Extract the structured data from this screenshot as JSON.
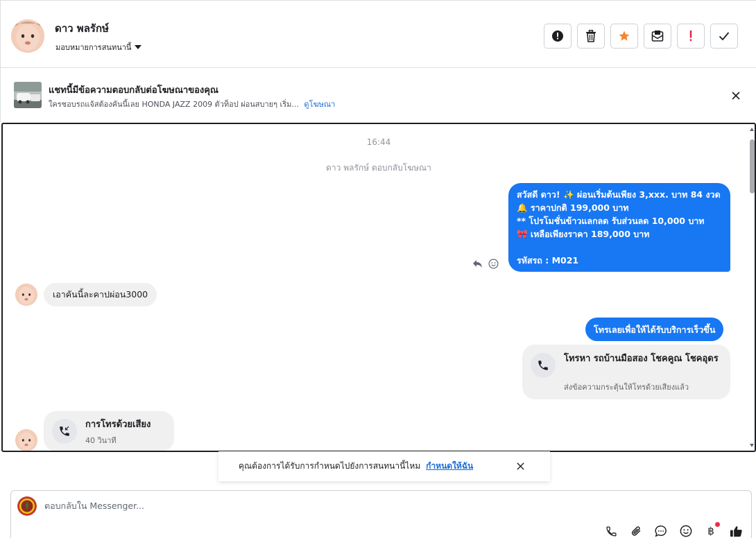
{
  "header": {
    "contact_name": "ดาว พลรักษ์",
    "assign_label": "มอบหมายการสนทนานี้",
    "actions": [
      {
        "icon": "exclamation-circle-icon"
      },
      {
        "icon": "trash-icon"
      },
      {
        "icon": "star-icon"
      },
      {
        "icon": "mark-unread-icon"
      },
      {
        "icon": "spam-exclamation-icon"
      },
      {
        "icon": "check-icon"
      }
    ]
  },
  "ad_banner": {
    "title": "แชทนี้มีข้อความตอบกลับต่อโฆษณาของคุณ",
    "snippet": "ใครชอบรถแจ้สต้องคันนี้เลย HONDA JAZZ 2009 ตัวท็อป ผ่อนสบายๆ เริ่ม...",
    "link": "ดูโฆษณา"
  },
  "chat": {
    "timestamp": "16:44",
    "replied_note": "ดาว พลรักษ์ ตอบกลับโฆษณา",
    "outgoing_ad_message": {
      "lines": [
        "สวัสดี ดาว! ✨  ผ่อนเริ่มต้นเพียง 3,xxx. บาท 84 งวด",
        "🔔 ราคาปกติ 199,000 บาท",
        "** โปรโมชั่นข้าวแลกลด รับส่วนลด 10,000 บาท",
        "🎀  เหลือเพียงราคา 189,000 บาท",
        "",
        " รหัสรถ : M021"
      ]
    },
    "incoming_message": "เอาคันนี้ละคาปผ่อน3000",
    "outgoing_call_prompt": "โทรเลยเพื่อให้ได้รับบริการเร็วขึ้น",
    "call_card": {
      "title": "โทรหา รถบ้านมือสอง โชคคูณ โชคอุดร",
      "subtitle": "ส่งข้อความกระตุ้นให้โทรด้วยเสียงแล้ว"
    },
    "voice_call_card": {
      "title": "การโทรด้วยเสียง",
      "duration": "40 วินาที"
    }
  },
  "toast": {
    "text": "คุณต้องการได้รับการกำหนดไปยังการสนทนานี้ไหม",
    "link": "กำหนดให้ฉัน"
  },
  "composer": {
    "placeholder": "ตอบกลับใน Messenger...",
    "baht_symbol": "฿",
    "tools": [
      "phone-icon",
      "paperclip-icon",
      "chat-bubble-icon",
      "emoji-icon",
      "baht-icon",
      "thumbs-up-icon"
    ]
  },
  "colors": {
    "brand_blue": "#1877f2",
    "star_orange": "#f5852f",
    "spam_red": "#e41e3f",
    "link_blue": "#1a6bd6",
    "incoming_bubble": "#f0f0f0"
  }
}
